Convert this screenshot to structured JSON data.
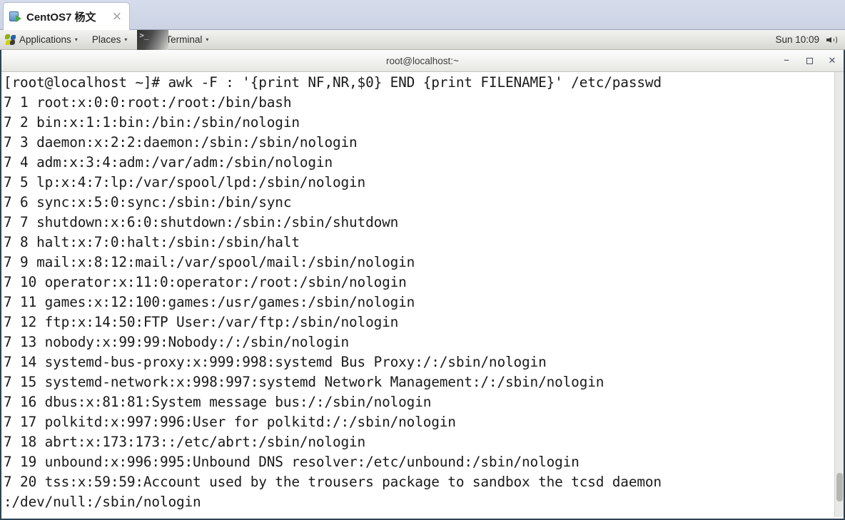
{
  "vm_tab": {
    "label": "CentOS7 杨文",
    "icon": "virtual-machine-icon",
    "close_label": "×"
  },
  "gnome_panel": {
    "applications_label": "Applications",
    "places_label": "Places",
    "terminal_label": "Terminal",
    "caret": "▾",
    "clock": "Sun 10:09",
    "volume_icon": "speaker-icon"
  },
  "terminal_window": {
    "title": "root@localhost:~",
    "minimize_label": "–",
    "maximize_label": "",
    "close_label": "✕"
  },
  "terminal": {
    "prompt_line": "[root@localhost ~]# awk -F : '{print NF,NR,$0} END {print FILENAME}' /etc/passwd",
    "lines": [
      "7 1 root:x:0:0:root:/root:/bin/bash",
      "7 2 bin:x:1:1:bin:/bin:/sbin/nologin",
      "7 3 daemon:x:2:2:daemon:/sbin:/sbin/nologin",
      "7 4 adm:x:3:4:adm:/var/adm:/sbin/nologin",
      "7 5 lp:x:4:7:lp:/var/spool/lpd:/sbin/nologin",
      "7 6 sync:x:5:0:sync:/sbin:/bin/sync",
      "7 7 shutdown:x:6:0:shutdown:/sbin:/sbin/shutdown",
      "7 8 halt:x:7:0:halt:/sbin:/sbin/halt",
      "7 9 mail:x:8:12:mail:/var/spool/mail:/sbin/nologin",
      "7 10 operator:x:11:0:operator:/root:/sbin/nologin",
      "7 11 games:x:12:100:games:/usr/games:/sbin/nologin",
      "7 12 ftp:x:14:50:FTP User:/var/ftp:/sbin/nologin",
      "7 13 nobody:x:99:99:Nobody:/:/sbin/nologin",
      "7 14 systemd-bus-proxy:x:999:998:systemd Bus Proxy:/:/sbin/nologin",
      "7 15 systemd-network:x:998:997:systemd Network Management:/:/sbin/nologin",
      "7 16 dbus:x:81:81:System message bus:/:/sbin/nologin",
      "7 17 polkitd:x:997:996:User for polkitd:/:/sbin/nologin",
      "7 18 abrt:x:173:173::/etc/abrt:/sbin/nologin",
      "7 19 unbound:x:996:995:Unbound DNS resolver:/etc/unbound:/sbin/nologin",
      "7 20 tss:x:59:59:Account used by the trousers package to sandbox the tcsd daemon",
      ":/dev/null:/sbin/nologin"
    ]
  }
}
